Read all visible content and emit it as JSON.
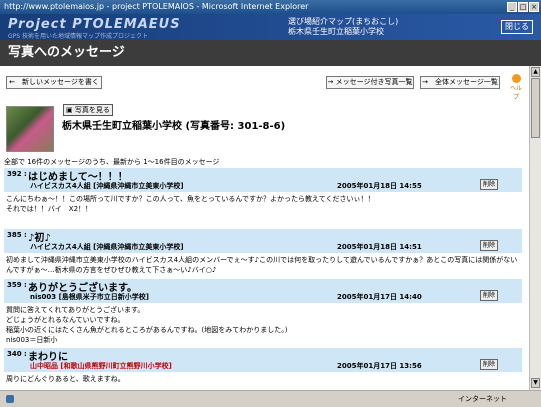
{
  "window": {
    "title": "http://www.ptolemaios.jp - project PTOLEMAIOS - Microsoft Internet Explorer"
  },
  "banner": {
    "logo": "Project PTOLEMAEUS",
    "sub": "GPS 技術を用いた地域情報マップ作成プロジェクト",
    "line1": "選び場紹介マップ(まちおこし)",
    "line2": "栃木県壬生町立稲葉小学校",
    "close_label": "閉じる"
  },
  "page": {
    "title": "写真へのメッセージ"
  },
  "toolbar": {
    "new_message": "←　新しいメッセージを書く",
    "photos_with_messages": "→ メッセージ付き写真一覧",
    "all_messages": "→　全体メッセージ一覧",
    "help": "ヘルプ"
  },
  "photo": {
    "view_button": "写真を見る",
    "title": "栃木県壬生町立稲葉小学校 (写真番号: 301-8-6)"
  },
  "summary": "全部で 16件のメッセージのうち、最新から 1〜16件目のメッセージ",
  "messages": [
    {
      "no": "392 :",
      "subject": "はじめまして〜！！！",
      "author": "ハイビスカス4人組 [沖縄県沖縄市立美東小学校]",
      "date": "2005年01月18日 14:55",
      "delete": "削除",
      "body": "こんにちわぁ〜！！この場所って川ですか？この人って、魚をとっているんですか？よかったら教えてくださいぃ！！\nそれでは！！バイ　X2！！"
    },
    {
      "no": "385 :",
      "subject": "♪初♪",
      "author": "ハイビスカス4人組 [沖縄県沖縄市立美東小学校]",
      "date": "2005年01月18日 14:51",
      "delete": "削除",
      "body": "初めまして沖縄県沖縄市立美東小学校のハイビスカス4人組のメンバーでぇ〜す♪この川では何を取ったりして遊んでいるんですかぁ？あとこの写真には関係がないんですがぁ〜…栃木県の方言をぜひぜひ教えて下さぁ〜い♪バイ○♪"
    },
    {
      "no": "359 :",
      "subject": "ありがとうございます。",
      "author": "nis003 [島根県米子市立日新小学校]",
      "date": "2005年01月17日 14:40",
      "delete": "削除",
      "body": "質問に答えてくれてありがとうございます。\nどじょうがとれるなんていいですね。\n稲葉小の近くにはたくさん魚がとれるところがあるんですね。(地図をみてわかりました。)\nnis003＝日新小"
    },
    {
      "no": "340 :",
      "subject": "まわりに",
      "author": "山中昭品 [和歌山県熊野川町立熊野川小学校]",
      "date": "2005年01月17日 13:56",
      "delete": "削除",
      "body": "周りにどんぐりあると、歌えますね。"
    }
  ],
  "status": {
    "zone": "インターネット"
  }
}
